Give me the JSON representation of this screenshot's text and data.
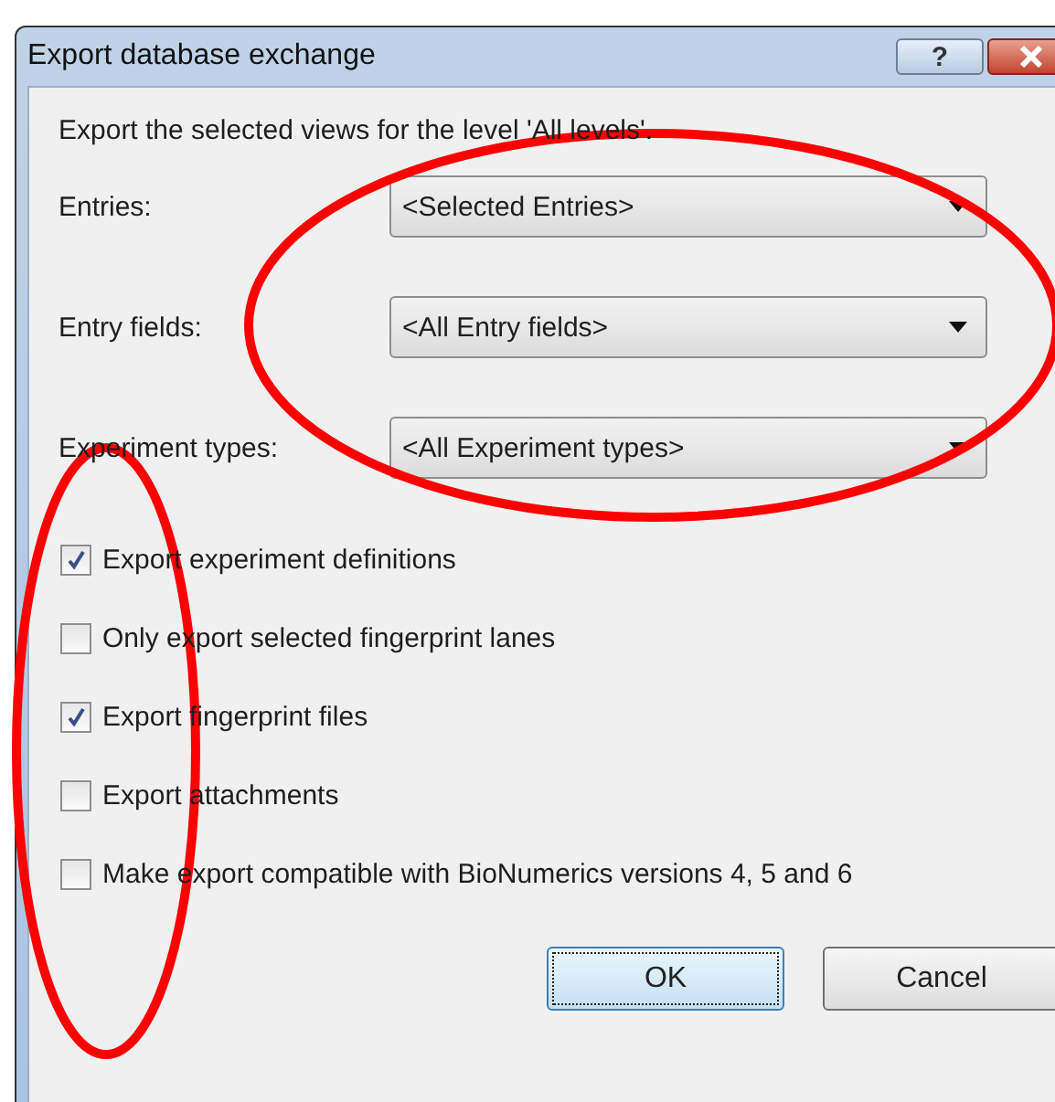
{
  "window": {
    "title": "Export database exchange",
    "help_button": "?"
  },
  "intro": "Export the selected views for the level 'All levels'.",
  "fields": [
    {
      "label": "Entries:",
      "value": "<Selected Entries>"
    },
    {
      "label": "Entry fields:",
      "value": "<All Entry fields>"
    },
    {
      "label": "Experiment types:",
      "value": "<All Experiment types>"
    }
  ],
  "options": [
    {
      "label": "Export experiment definitions",
      "checked": true
    },
    {
      "label": "Only export selected fingerprint lanes",
      "checked": false
    },
    {
      "label": "Export fingerprint files",
      "checked": true
    },
    {
      "label": "Export attachments",
      "checked": false
    },
    {
      "label": "Make export compatible with BioNumerics versions 4, 5 and 6",
      "checked": false
    }
  ],
  "buttons": [
    {
      "label": "OK",
      "default": true
    },
    {
      "label": "Cancel",
      "default": false
    }
  ],
  "annotations": [
    {
      "kind": "ellipse",
      "color": "#ff0000"
    },
    {
      "kind": "ellipse",
      "color": "#ff0000"
    }
  ]
}
